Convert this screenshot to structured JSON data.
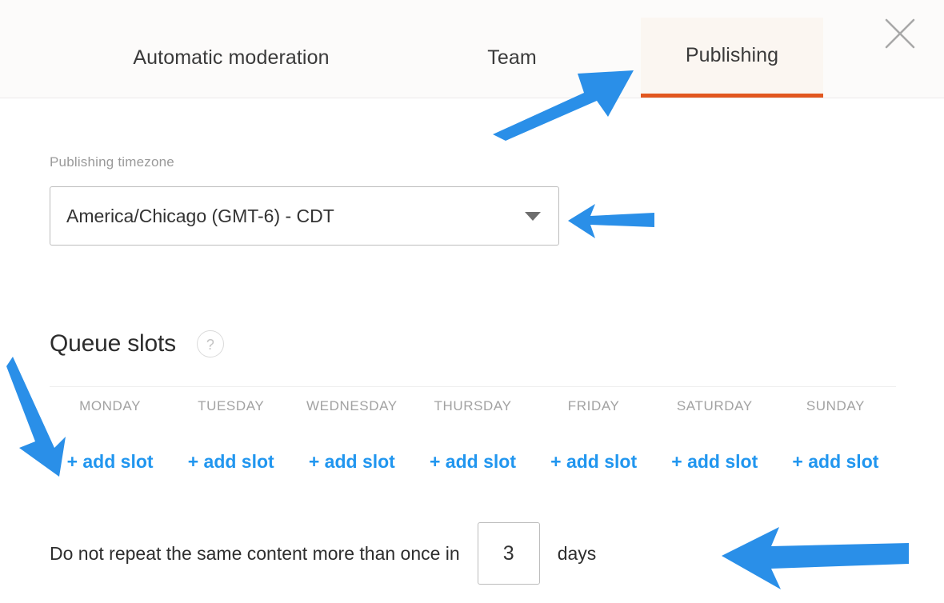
{
  "window": {
    "close_label": "Close"
  },
  "tabs": [
    {
      "id": "automatic-moderation",
      "label": "Automatic moderation",
      "active": false
    },
    {
      "id": "team",
      "label": "Team",
      "active": false
    },
    {
      "id": "publishing",
      "label": "Publishing",
      "active": true
    }
  ],
  "publishing": {
    "timezone_label": "Publishing timezone",
    "timezone_value": "America/Chicago (GMT-6) - CDT",
    "queue_slots": {
      "title": "Queue slots",
      "help_glyph": "?",
      "days": [
        {
          "name": "MONDAY",
          "add_label": "+ add slot"
        },
        {
          "name": "TUESDAY",
          "add_label": "+ add slot"
        },
        {
          "name": "WEDNESDAY",
          "add_label": "+ add slot"
        },
        {
          "name": "THURSDAY",
          "add_label": "+ add slot"
        },
        {
          "name": "FRIDAY",
          "add_label": "+ add slot"
        },
        {
          "name": "SATURDAY",
          "add_label": "+ add slot"
        },
        {
          "name": "SUNDAY",
          "add_label": "+ add slot"
        }
      ]
    },
    "repeat_rule": {
      "text": "Do not repeat the same content more than once in",
      "value": "3",
      "unit": "days"
    }
  },
  "colors": {
    "accent_orange": "#e2571f",
    "active_tab_bg": "#fbf6f1",
    "link_blue": "#2196ef",
    "annotation_blue": "#2a8fe8",
    "muted_text": "#a2a2a2"
  },
  "annotations": [
    {
      "id": "arrow-to-publishing-tab",
      "points_to": "publishing-tab",
      "direction": "up-right"
    },
    {
      "id": "arrow-to-timezone-select",
      "points_to": "timezone-select",
      "direction": "left"
    },
    {
      "id": "arrow-to-add-slot",
      "points_to": "add-slot-monday",
      "direction": "down-right"
    },
    {
      "id": "arrow-to-days-input",
      "points_to": "repeat-days-input",
      "direction": "left"
    }
  ]
}
